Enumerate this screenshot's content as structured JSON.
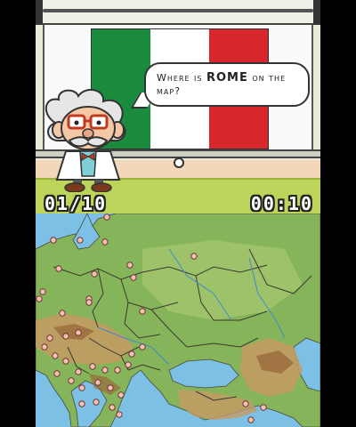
{
  "question": {
    "prefix": "Where is ",
    "city": "ROME",
    "suffix": " on the map?"
  },
  "flag": {
    "country": "Italy",
    "stripes": [
      "#1a8a3c",
      "#ffffff",
      "#d8262d"
    ]
  },
  "hud": {
    "progress": "01/10",
    "timer": "00:10"
  },
  "colors": {
    "sea": "#7cc0e6",
    "lowland": "#86b45a",
    "highland": "#c59a64",
    "mountain": "#9a6a3c",
    "city_dot": "#f6c0b8"
  },
  "map": {
    "icons": [
      "city-dot-icon"
    ]
  }
}
